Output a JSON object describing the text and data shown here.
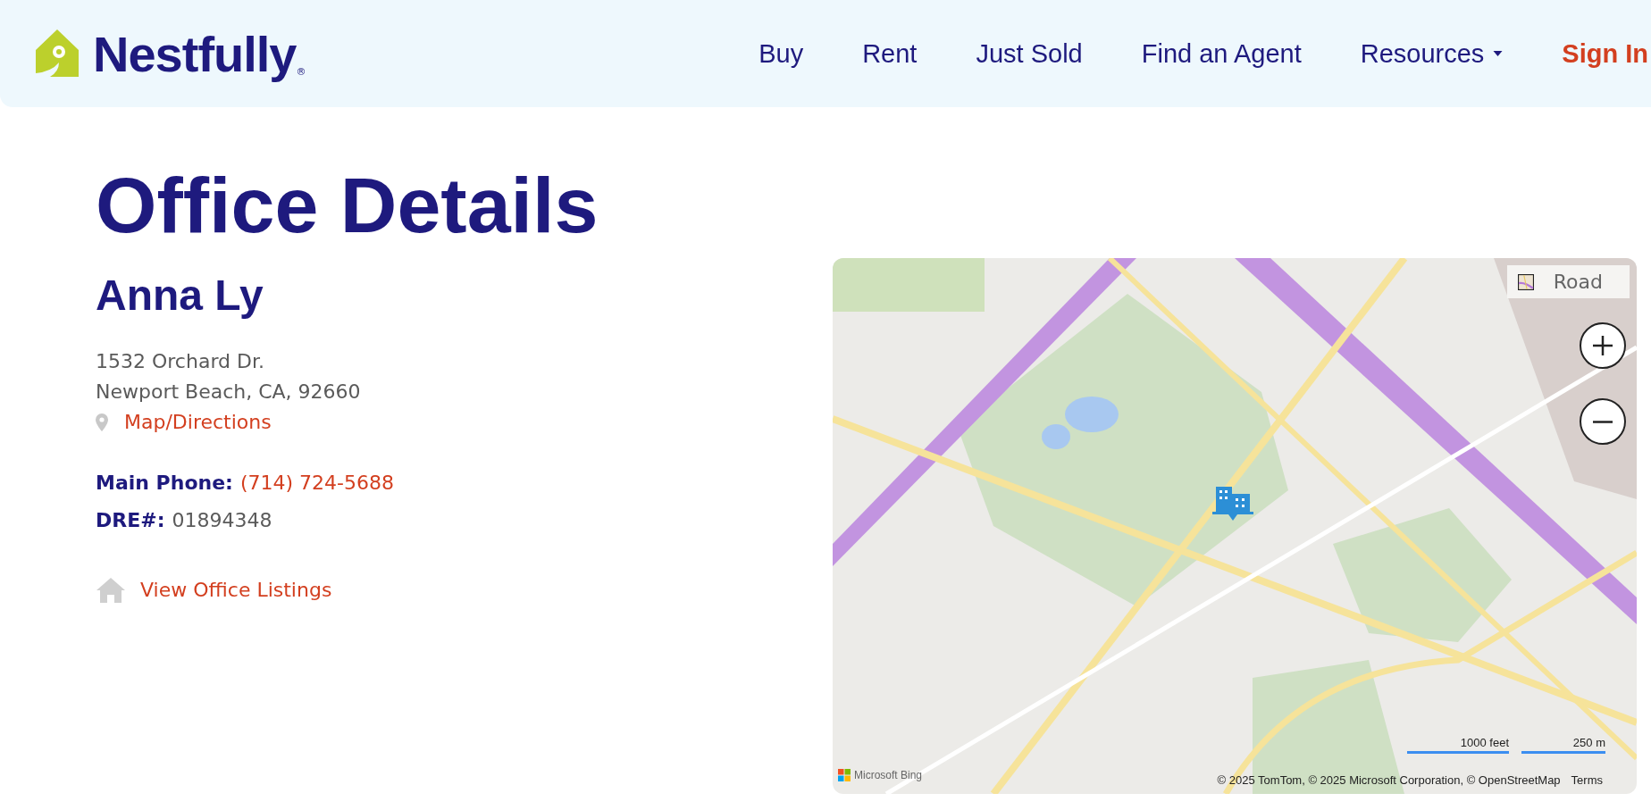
{
  "header": {
    "brand": "Nestfully",
    "brand_mark": "®",
    "nav": [
      {
        "label": "Buy",
        "kind": "link"
      },
      {
        "label": "Rent",
        "kind": "link"
      },
      {
        "label": "Just Sold",
        "kind": "link"
      },
      {
        "label": "Find an Agent",
        "kind": "link"
      },
      {
        "label": "Resources",
        "kind": "dropdown"
      },
      {
        "label": "Sign In",
        "kind": "signin"
      }
    ]
  },
  "page_title": "Office Details",
  "office": {
    "name": "Anna Ly",
    "address_lines": [
      "1532 Orchard Dr.",
      "Newport Beach, CA, 92660"
    ],
    "map_link": "Map/Directions",
    "phone_label": "Main Phone:",
    "phone": "(714) 724-5688",
    "dre_label": "DRE#:",
    "dre": "01894348",
    "listings_link": "View Office Listings"
  },
  "map": {
    "kind": "picture",
    "style_button": "Road",
    "scale": [
      "1000 feet",
      "250 m"
    ],
    "provider": "Microsoft Bing",
    "attribution": "© 2025 TomTom, © 2025 Microsoft Corporation, © OpenStreetMap",
    "terms": "Terms"
  }
}
